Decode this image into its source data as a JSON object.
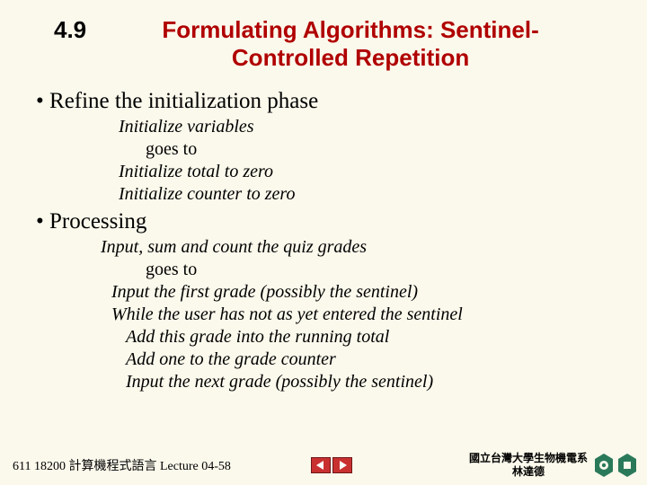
{
  "header": {
    "section_number": "4.9",
    "title": "Formulating Algorithms: Sentinel-Controlled Repetition"
  },
  "bullets": {
    "b1": "Refine the initialization phase",
    "b1_sub1": "Initialize variables",
    "b1_goes": "goes to",
    "b1_sub2": "Initialize total to zero",
    "b1_sub3": "Initialize counter to zero",
    "b2": "Processing",
    "b2_sub1": "Input, sum and count the quiz grades",
    "b2_goes": "goes to",
    "b2_sub2": "Input the first grade (possibly the sentinel)",
    "b2_sub3": "While the user has not as yet entered the sentinel",
    "b2_sub4": "Add this grade into the running total",
    "b2_sub5": "Add one to the grade counter",
    "b2_sub6": "Input the next grade (possibly the sentinel)"
  },
  "footer": {
    "left": "611 18200 計算機程式語言  Lecture 04-58",
    "affil_line1": "國立台灣大學生物機電系",
    "affil_line2": "林達德"
  }
}
